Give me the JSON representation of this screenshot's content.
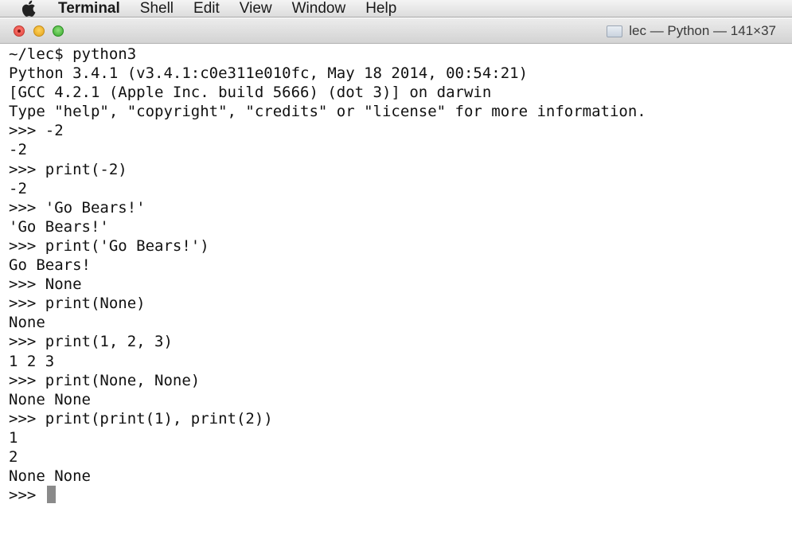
{
  "menubar": {
    "apple_icon": "apple-icon",
    "items": [
      "Terminal",
      "Shell",
      "Edit",
      "View",
      "Window",
      "Help"
    ]
  },
  "window": {
    "title": "lec — Python — 141×37",
    "title_icon": "folder-icon",
    "colors": {
      "close": "#e0443e",
      "minimize": "#e2a21c",
      "zoom": "#36a82c"
    }
  },
  "terminal": {
    "lines": [
      "~/lec$ python3",
      "Python 3.4.1 (v3.4.1:c0e311e010fc, May 18 2014, 00:54:21)",
      "[GCC 4.2.1 (Apple Inc. build 5666) (dot 3)] on darwin",
      "Type \"help\", \"copyright\", \"credits\" or \"license\" for more information.",
      ">>> -2",
      "-2",
      ">>> print(-2)",
      "-2",
      ">>> 'Go Bears!'",
      "'Go Bears!'",
      ">>> print('Go Bears!')",
      "Go Bears!",
      ">>> None",
      ">>> print(None)",
      "None",
      ">>> print(1, 2, 3)",
      "1 2 3",
      ">>> print(None, None)",
      "None None",
      ">>> print(print(1), print(2))",
      "1",
      "2",
      "None None"
    ],
    "prompt": ">>> "
  }
}
